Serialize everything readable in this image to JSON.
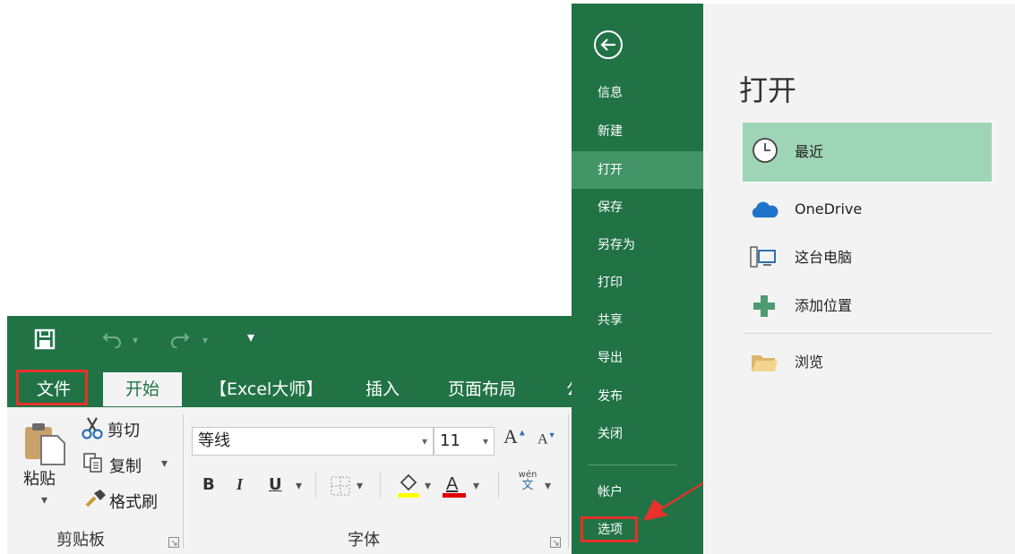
{
  "ribbon": {
    "qat": {
      "dropdown_glyph": "▾"
    },
    "tabs": [
      "文件",
      "开始",
      "【Excel大师】",
      "插入",
      "页面布局",
      "公"
    ],
    "clipboard": {
      "paste_label": "粘贴",
      "cut_label": "剪切",
      "copy_label": "复制",
      "format_painter_label": "格式刷",
      "group_label": "剪贴板"
    },
    "font": {
      "font_name": "等线",
      "font_size": "11",
      "bold": "B",
      "italic": "I",
      "underline": "U",
      "group_label": "字体",
      "phonetic_top": "wén",
      "phonetic_bottom": "文"
    }
  },
  "backstage": {
    "menu": [
      "信息",
      "新建",
      "打开",
      "保存",
      "另存为",
      "打印",
      "共享",
      "导出",
      "发布",
      "关闭"
    ],
    "account": "帐户",
    "options": "选项",
    "selected": "打开",
    "page_title": "打开",
    "locations": [
      "最近",
      "OneDrive",
      "这台电脑",
      "添加位置",
      "浏览"
    ]
  },
  "colors": {
    "excel_green": "#217346",
    "selected_green": "#439467",
    "recent_highlight": "#9fd5b7",
    "annotation_red": "#e8312a"
  }
}
